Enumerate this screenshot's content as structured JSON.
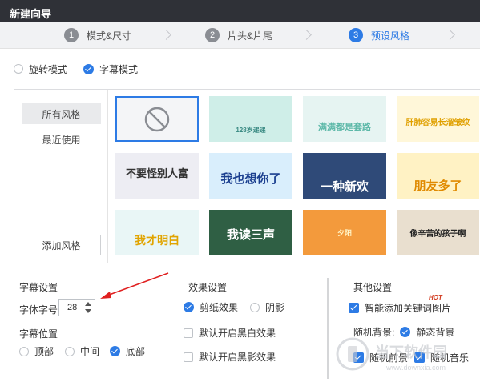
{
  "window": {
    "title": "新建向导"
  },
  "steps": [
    {
      "num": "1",
      "label": "模式&尺寸",
      "active": false
    },
    {
      "num": "2",
      "label": "片头&片尾",
      "active": false
    },
    {
      "num": "3",
      "label": "预设风格",
      "active": true
    }
  ],
  "modes": {
    "rotate": "旋转模式",
    "subtitle": "字幕模式",
    "selected": "subtitle"
  },
  "sidebar": {
    "items": [
      {
        "label": "所有风格",
        "selected": true
      },
      {
        "label": "最近使用",
        "selected": false
      }
    ],
    "add_label": "添加风格"
  },
  "thumbnails": [
    {
      "caption": "",
      "bg": "#f4f5f7",
      "fg": "#8a8d93",
      "icon": "ban-icon"
    },
    {
      "caption": "128岁递递",
      "bg": "#cfeee8",
      "fg": "#3a8a83"
    },
    {
      "caption": "满满都是套路",
      "bg": "#e6f4f2",
      "fg": "#5cb8a8"
    },
    {
      "caption": "肝肺容易长溜皱纹",
      "bg": "#fff7d9",
      "fg": "#e0a000"
    },
    {
      "caption": "不要怪别人富",
      "bg": "#ededf3",
      "fg": "#333333"
    },
    {
      "caption": "我也想你了",
      "bg": "#d9eefc",
      "fg": "#1b3f8f"
    },
    {
      "caption": "一种新欢",
      "bg": "#2f4a78",
      "fg": "#ffffff"
    },
    {
      "caption": "朋友多了",
      "bg": "#fff2c4",
      "fg": "#e08a00"
    },
    {
      "caption": "我才明白",
      "bg": "#e9f6f6",
      "fg": "#e1a400"
    },
    {
      "caption": "我读三声",
      "bg": "#2f5f44",
      "fg": "#ffffff"
    },
    {
      "caption": "夕阳",
      "bg": "#f39a3c",
      "fg": "#fff4c7"
    },
    {
      "caption": "像辛苦的孩子啊",
      "bg": "#e9dfcf",
      "fg": "#222222"
    }
  ],
  "subtitle_settings": {
    "title": "字幕设置",
    "font_size_label": "字体字号",
    "font_size_value": "28",
    "position_label": "字幕位置",
    "positions": [
      {
        "label": "顶部",
        "checked": false
      },
      {
        "label": "中间",
        "checked": false
      },
      {
        "label": "底部",
        "checked": true
      }
    ]
  },
  "effect_settings": {
    "title": "效果设置",
    "paper_cut": "剪纸效果",
    "paper_cut_checked": true,
    "shadow": "阴影",
    "shadow_checked": false,
    "black_white": "默认开启黑白效果",
    "black_white_checked": false,
    "black_shadow": "默认开启黑影效果",
    "black_shadow_checked": false
  },
  "other_settings": {
    "title": "其他设置",
    "smart_keyword": "智能添加关键词图片",
    "smart_keyword_checked": true,
    "hot_badge": "HOT",
    "random_bg_label": "随机背景:",
    "static_bg": "静态背景",
    "static_bg_checked": true,
    "random_fg": "随机前景",
    "random_fg_checked": true,
    "random_music": "随机音乐",
    "random_music_checked": true
  },
  "watermark": {
    "text": "当下软件园",
    "url": "www.downxia.com"
  },
  "colors": {
    "accent": "#2d7be5",
    "annotation_arrow": "#e02020",
    "titlebar": "#2f3137"
  }
}
